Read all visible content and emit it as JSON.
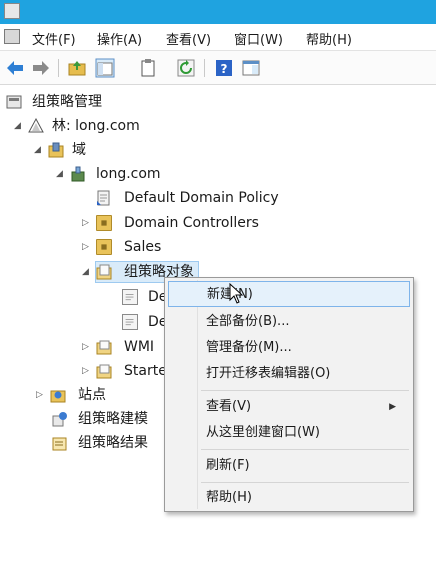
{
  "menu": [
    "文件(F)",
    "操作(A)",
    "查看(V)",
    "窗口(W)",
    "帮助(H)"
  ],
  "tree": {
    "root": "组策略管理",
    "forest": "林: long.com",
    "domains": "域",
    "domain": "long.com",
    "default_policy": "Default Domain Policy",
    "domain_controllers": "Domain Controllers",
    "sales": "Sales",
    "gpo_objects": "组策略对象",
    "child1": "De",
    "child2": "De",
    "wmi": "WMI",
    "starter": "Starte",
    "sites": "站点",
    "modeling": "组策略建模",
    "results": "组策略结果"
  },
  "context_menu": {
    "new": "新建(N)",
    "backup_all": "全部备份(B)...",
    "manage_backups": "管理备份(M)...",
    "open_migration": "打开迁移表编辑器(O)",
    "view": "查看(V)",
    "new_window": "从这里创建窗口(W)",
    "refresh": "刷新(F)",
    "help": "帮助(H)"
  }
}
